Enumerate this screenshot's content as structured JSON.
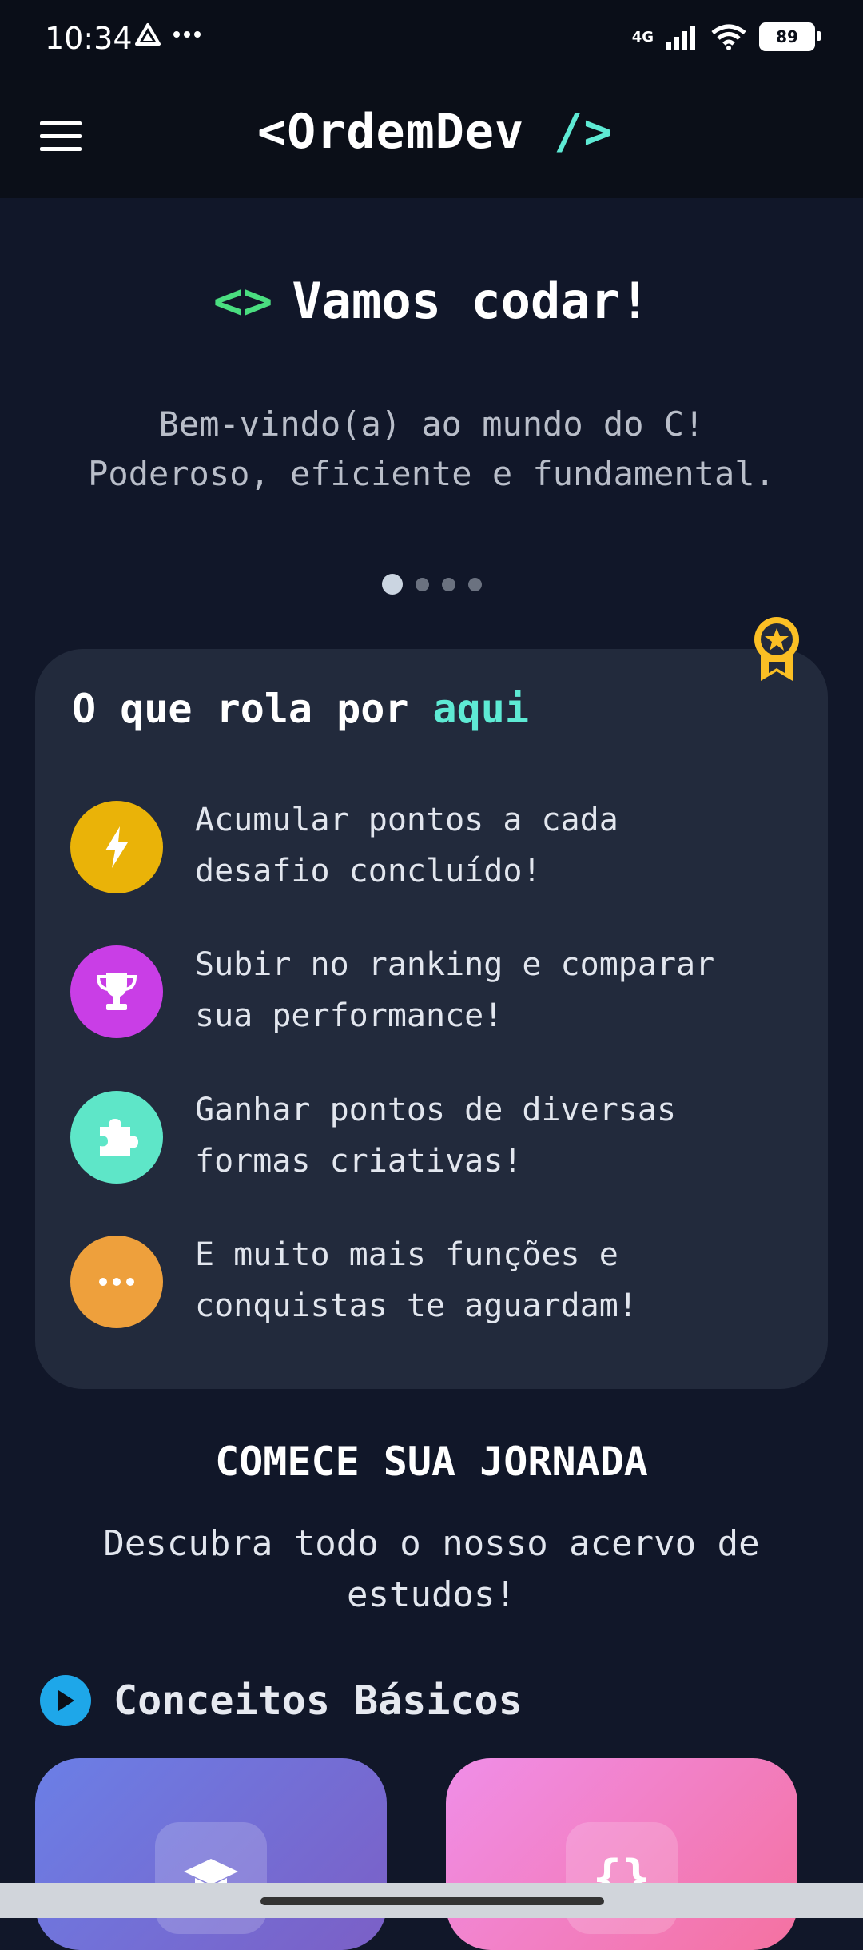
{
  "status": {
    "time": "10:34",
    "network": "4G",
    "battery": "89"
  },
  "header": {
    "logo_prefix": "<OrdemDev",
    "logo_suffix": "/>"
  },
  "hero": {
    "title": "Vamos codar!",
    "subtitle_line1": "Bem-vindo(a) ao mundo do C!",
    "subtitle_line2": "Poderoso, eficiente e fundamental."
  },
  "carousel": {
    "pages": 4,
    "active": 1
  },
  "features": {
    "title_prefix": "O que rola por",
    "title_accent": "aqui",
    "items": [
      {
        "text": "Acumular pontos a cada\ndesafio concluído!",
        "icon": "lightning-icon",
        "color": "#eab308"
      },
      {
        "text": "Subir no ranking e comparar\nsua performance!",
        "icon": "trophy-icon",
        "color": "#c93ee6"
      },
      {
        "text": "Ganhar pontos de diversas\nformas criativas!",
        "icon": "puzzle-icon",
        "color": "#5ee6c8"
      },
      {
        "text": "E muito mais funções e\nconquistas te aguardam!",
        "icon": "more-icon",
        "color": "#eea03c"
      }
    ]
  },
  "journey": {
    "title": "COMECE SUA JORNADA",
    "subtitle_line1": "Descubra todo o nosso acervo de",
    "subtitle_line2": "estudos!"
  },
  "section": {
    "title": "Conceitos Básicos"
  },
  "course_cards": [
    {
      "icon": "graduation-cap-icon",
      "color_start": "#6b7fe6",
      "color_end": "#7b5fc6"
    },
    {
      "icon": "braces-icon",
      "glyph": "{}",
      "color_start": "#f08ee8",
      "color_end": "#f471a0"
    }
  ]
}
